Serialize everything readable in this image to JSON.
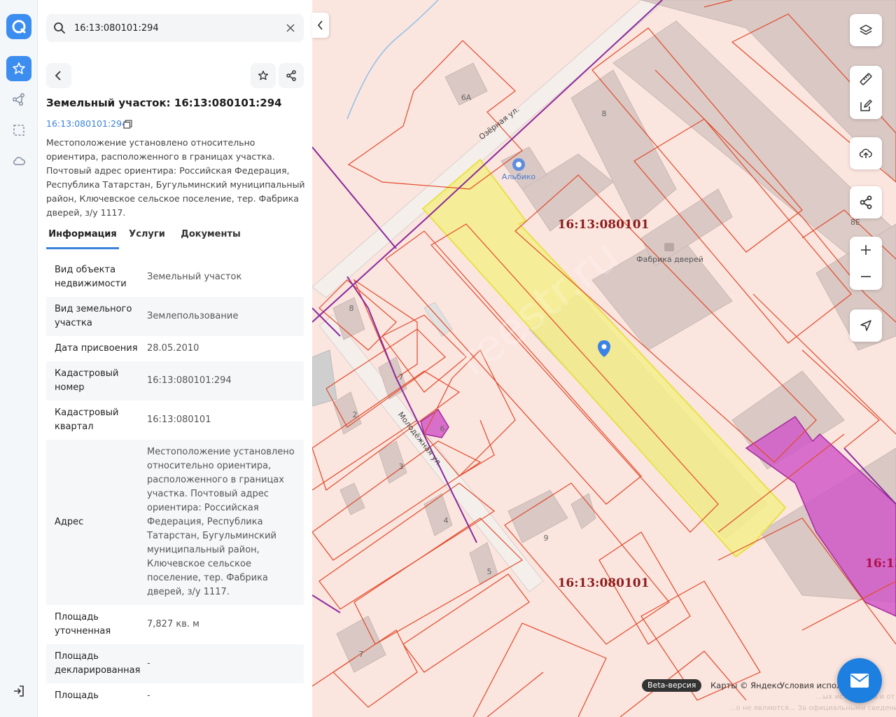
{
  "search": {
    "value": "16:13:080101:294"
  },
  "card": {
    "title": "Земельный участок: 16:13:080101:294",
    "cad_link": "16:13:080101:294",
    "description": "Местоположение установлено относительно ориентира, расположенного в границах участка. Почтовый адрес ориентира: Российская Федерация, Республика Татарстан, Бугульминский муниципальный район, Ключевское сельское поселение, тер. Фабрика дверей, з/у 1117."
  },
  "tabs": [
    {
      "label": "Информация",
      "active": true
    },
    {
      "label": "Услуги",
      "active": false
    },
    {
      "label": "Документы",
      "active": false
    }
  ],
  "info_rows": [
    {
      "key": "Вид объекта недвижимости",
      "value": "Земельный участок"
    },
    {
      "key": "Вид земельного участка",
      "value": "Землепользование"
    },
    {
      "key": "Дата присвоения",
      "value": "28.05.2010"
    },
    {
      "key": "Кадастровый номер",
      "value": "16:13:080101:294"
    },
    {
      "key": "Кадастровый квартал",
      "value": "16:13:080101"
    },
    {
      "key": "Адрес",
      "value": "Местоположение установлено относительно ориентира, расположенного в границах участка. Почтовый адрес ориентира: Российская Федерация, Республика Татарстан, Бугульминский муниципальный район, Ключевское сельское поселение, тер. Фабрика дверей, з/у 1117."
    },
    {
      "key": "Площадь уточненная",
      "value": "7,827 кв. м"
    },
    {
      "key": "Площадь декларированная",
      "value": "-"
    },
    {
      "key": "Площадь",
      "value": "-"
    }
  ],
  "map": {
    "labels": {
      "quarter_1": "16:13:080101",
      "quarter_2": "16:13:080101",
      "quarter_3": "16:13",
      "street_ozernaya": "Озёрная ул.",
      "street_molodezhnaya": "Молодёжная ул.",
      "poi_albiko": "Альбико",
      "poi_factory": "Фабрика дверей",
      "house_6a": "6А",
      "house_8_top": "8",
      "house_8e": "8Е",
      "house_8_left": "8",
      "house_7_a": "7",
      "house_2": "2",
      "house_6": "6",
      "house_3": "3",
      "house_4": "4",
      "house_5": "5",
      "house_9": "9",
      "house_7_b": "7"
    },
    "watermark": "reestr.ru",
    "beta": "Beta-версия",
    "copyright": "Карты © Яндекс",
    "terms": "Условия испол",
    "disclaimer_1": "...ых источников и от данных Росреестра. Вся информация носит справочны...",
    "disclaimer_2": "...о не являются... За официальными сведениями обратитесь в Росреестр",
    "colors": {
      "selected_fill": "#f5ee8c",
      "selected_stroke": "#e8e04a",
      "parcel_stroke": "#e24a2a",
      "quarter_stroke": "#8a2b9c",
      "magenta": "#d05ac8",
      "accent": "#3b8df0"
    }
  }
}
